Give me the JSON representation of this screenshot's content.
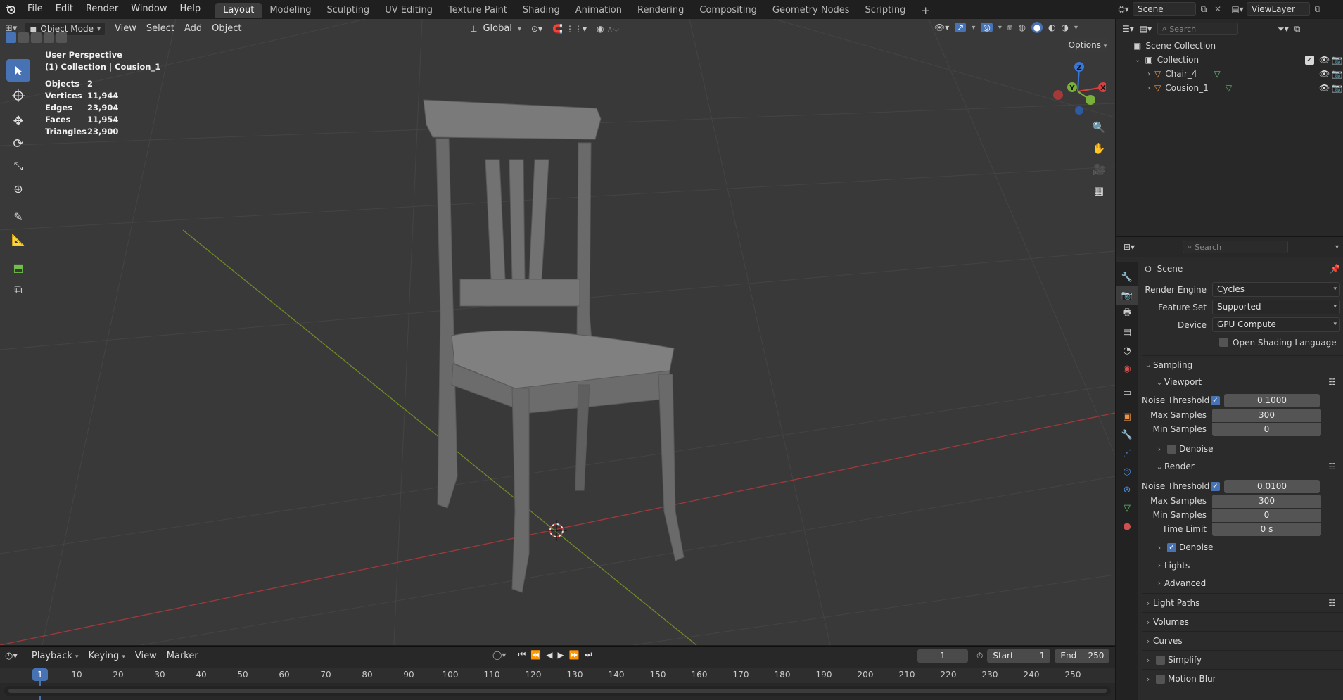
{
  "topbar": {
    "menus": [
      "File",
      "Edit",
      "Render",
      "Window",
      "Help"
    ],
    "workspaces": [
      "Layout",
      "Modeling",
      "Sculpting",
      "UV Editing",
      "Texture Paint",
      "Shading",
      "Animation",
      "Rendering",
      "Compositing",
      "Geometry Nodes",
      "Scripting"
    ],
    "active_workspace": "Layout",
    "add_tab": "+",
    "scene_name": "Scene",
    "view_layer": "ViewLayer"
  },
  "viewport": {
    "mode": "Object Mode",
    "menus": [
      "View",
      "Select",
      "Add",
      "Object"
    ],
    "orientation": "Global",
    "options_label": "Options",
    "info_title": "User Perspective",
    "info_subtitle": "(1) Collection | Cousion_1",
    "stats": [
      {
        "label": "Objects",
        "value": "2"
      },
      {
        "label": "Vertices",
        "value": "11,944"
      },
      {
        "label": "Edges",
        "value": "23,904"
      },
      {
        "label": "Faces",
        "value": "11,954"
      },
      {
        "label": "Triangles",
        "value": "23,900"
      }
    ],
    "gizmo": {
      "z": "Z",
      "y": "Y",
      "x": "X"
    },
    "colors": {
      "x_axis": "#b03a3a",
      "y_axis": "#7a9a2a",
      "active_tool": "#4772b3"
    }
  },
  "outliner": {
    "search_placeholder": "Search",
    "scene_collection": "Scene Collection",
    "collection": "Collection",
    "objects": [
      "Chair_4",
      "Cousion_1"
    ]
  },
  "properties": {
    "search_placeholder": "Search",
    "context": "Scene",
    "render_engine_label": "Render Engine",
    "render_engine": "Cycles",
    "feature_set_label": "Feature Set",
    "feature_set": "Supported",
    "device_label": "Device",
    "device": "GPU Compute",
    "osl_label": "Open Shading Language",
    "sampling": "Sampling",
    "viewport": {
      "title": "Viewport",
      "noise_threshold_label": "Noise Threshold",
      "noise_threshold": "0.1000",
      "max_samples_label": "Max Samples",
      "max_samples": "300",
      "min_samples_label": "Min Samples",
      "min_samples": "0",
      "denoise_label": "Denoise"
    },
    "render": {
      "title": "Render",
      "noise_threshold_label": "Noise Threshold",
      "noise_threshold": "0.0100",
      "max_samples_label": "Max Samples",
      "max_samples": "300",
      "min_samples_label": "Min Samples",
      "min_samples": "0",
      "time_limit_label": "Time Limit",
      "time_limit": "0 s",
      "denoise_label": "Denoise"
    },
    "sub_sections": [
      "Lights",
      "Advanced"
    ],
    "sections": [
      "Light Paths",
      "Volumes",
      "Curves",
      "Simplify",
      "Motion Blur"
    ]
  },
  "timeline": {
    "menus": [
      "Playback",
      "Keying",
      "View",
      "Marker"
    ],
    "current_frame": "1",
    "start_label": "Start",
    "start": "1",
    "end_label": "End",
    "end": "250",
    "ticks": [
      "10",
      "20",
      "30",
      "40",
      "50",
      "60",
      "70",
      "80",
      "90",
      "100",
      "110",
      "120",
      "130",
      "140",
      "150",
      "160",
      "170",
      "180",
      "190",
      "200",
      "210",
      "220",
      "230",
      "240",
      "250"
    ],
    "playhead": "1"
  }
}
